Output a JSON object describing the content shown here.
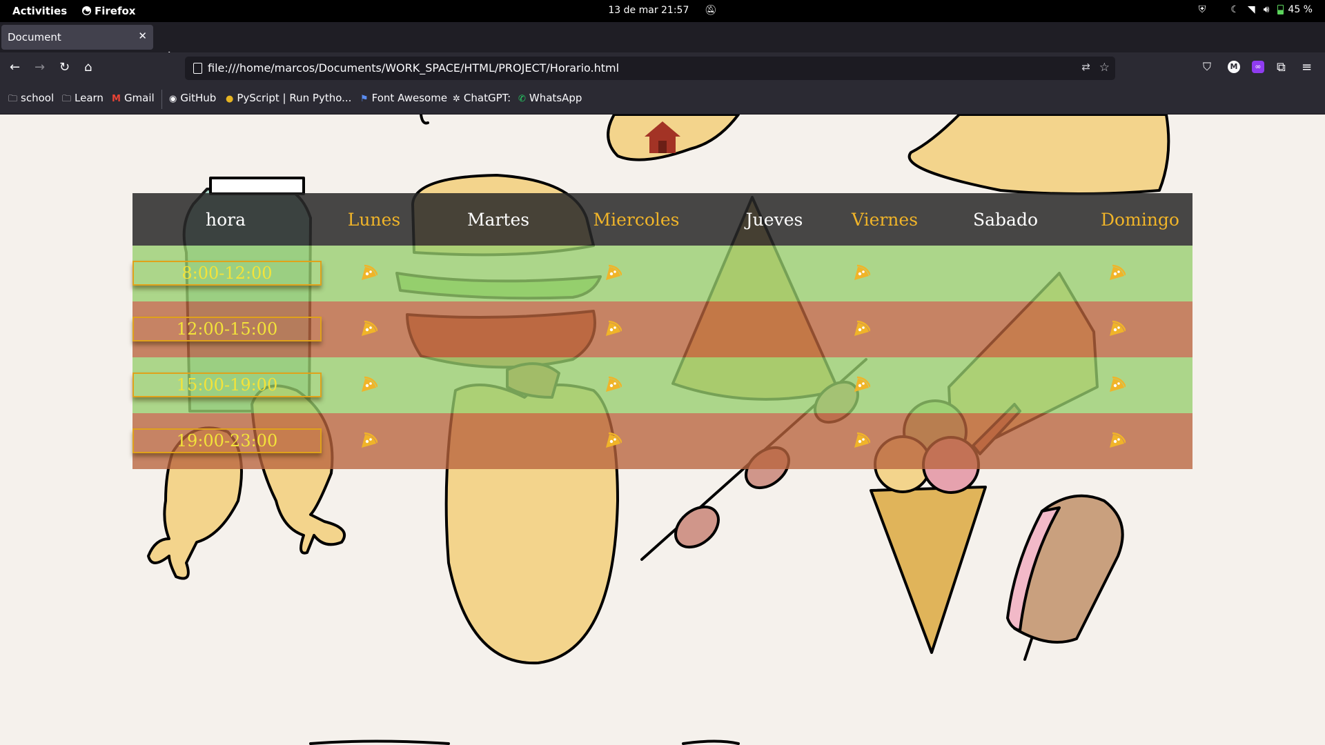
{
  "system_bar": {
    "activities": "Activities",
    "app_name": "Firefox",
    "clock": "13 de mar  21:57",
    "battery": "45 %"
  },
  "browser": {
    "tab_title": "Document",
    "url": "file:///home/marcos/Documents/WORK_SPACE/HTML/PROJECT/Horario.html",
    "bookmarks": [
      {
        "label": "school",
        "icon": "folder-icon"
      },
      {
        "label": "Learn",
        "icon": "folder-icon"
      },
      {
        "label": "Gmail",
        "icon": "gmail-icon"
      },
      {
        "label": "GitHub",
        "icon": "github-icon"
      },
      {
        "label": "PyScript | Run Pytho...",
        "icon": "pyscript-icon"
      },
      {
        "label": "Font Awesome",
        "icon": "flag-icon"
      },
      {
        "label": "ChatGPT:",
        "icon": "chatgpt-icon"
      },
      {
        "label": "WhatsApp",
        "icon": "whatsapp-icon"
      }
    ]
  },
  "schedule": {
    "header": [
      "hora",
      "Lunes",
      "Martes",
      "Miercoles",
      "Jueves",
      "Viernes",
      "Sabado",
      "Domingo"
    ],
    "header_colors": [
      "#ffffff",
      "#f0b429",
      "#ffffff",
      "#f0b429",
      "#ffffff",
      "#f0b429",
      "#ffffff",
      "#f0b429"
    ],
    "rows": [
      {
        "hour": "8:00-12:00",
        "color": "green",
        "pizza_days": [
          "Lunes",
          "Miercoles",
          "Viernes",
          "Domingo"
        ]
      },
      {
        "hour": "12:00-15:00",
        "color": "red",
        "pizza_days": [
          "Lunes",
          "Miercoles",
          "Viernes",
          "Domingo"
        ]
      },
      {
        "hour": "15:00-19:00",
        "color": "green",
        "pizza_days": [
          "Lunes",
          "Miercoles",
          "Viernes",
          "Domingo"
        ]
      },
      {
        "hour": "19:00-23:00",
        "color": "red",
        "pizza_days": [
          "Lunes",
          "Miercoles",
          "Viernes",
          "Domingo"
        ]
      }
    ],
    "icon": "pizza-slice-icon",
    "accent": "#f0b429",
    "row_green": "#97ce6e",
    "row_red": "#b9643e"
  }
}
